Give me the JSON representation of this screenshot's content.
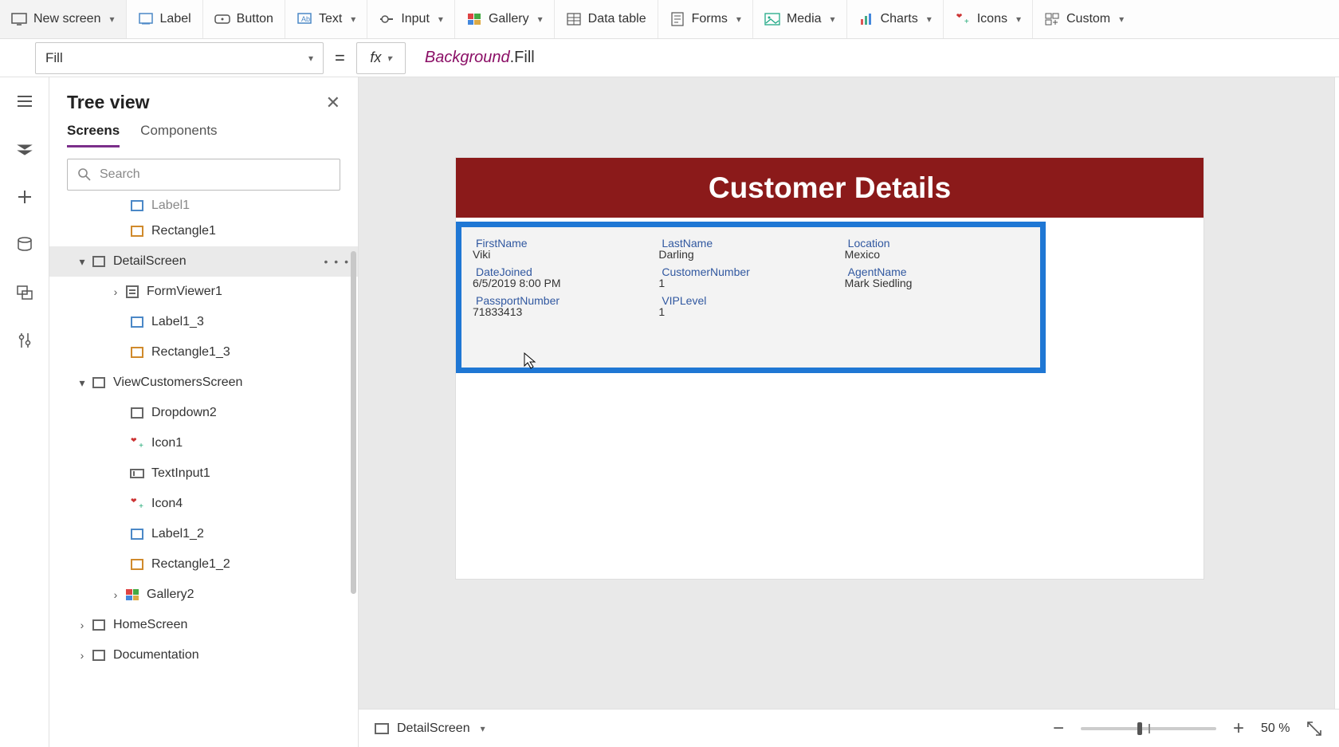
{
  "toolbar": {
    "newScreen": "New screen",
    "label": "Label",
    "button": "Button",
    "text": "Text",
    "input": "Input",
    "gallery": "Gallery",
    "dataTable": "Data table",
    "forms": "Forms",
    "media": "Media",
    "charts": "Charts",
    "icons": "Icons",
    "custom": "Custom"
  },
  "formulaBar": {
    "property": "Fill",
    "fx": "fx",
    "equals": "=",
    "tokId": "Background",
    "tokDot": ".",
    "tokProp": "Fill"
  },
  "treePanel": {
    "title": "Tree view",
    "tabScreens": "Screens",
    "tabComponents": "Components",
    "searchPlaceholder": "Search"
  },
  "tree": {
    "label1": "Label1",
    "rect1": "Rectangle1",
    "detailScreen": "DetailScreen",
    "formViewer1": "FormViewer1",
    "label1_3": "Label1_3",
    "rect1_3": "Rectangle1_3",
    "viewCustomers": "ViewCustomersScreen",
    "dropdown2": "Dropdown2",
    "icon1": "Icon1",
    "textInput1": "TextInput1",
    "icon4": "Icon4",
    "label1_2": "Label1_2",
    "rect1_2": "Rectangle1_2",
    "gallery2": "Gallery2",
    "homeScreen": "HomeScreen",
    "documentation": "Documentation",
    "moreDots": "• • •"
  },
  "canvas": {
    "header": "Customer Details",
    "fields": {
      "firstNameLbl": "FirstName",
      "firstNameVal": "Viki",
      "lastNameLbl": "LastName",
      "lastNameVal": "Darling",
      "locationLbl": "Location",
      "locationVal": "Mexico",
      "dateJoinedLbl": "DateJoined",
      "dateJoinedVal": "6/5/2019 8:00 PM",
      "custNumLbl": "CustomerNumber",
      "custNumVal": "1",
      "agentLbl": "AgentName",
      "agentVal": "Mark Siedling",
      "passportLbl": "PassportNumber",
      "passportVal": "71833413",
      "vipLbl": "VIPLevel",
      "vipVal": "1"
    }
  },
  "statusbar": {
    "screenName": "DetailScreen",
    "zoomPct": "50 %",
    "minus": "−",
    "plus": "+"
  }
}
